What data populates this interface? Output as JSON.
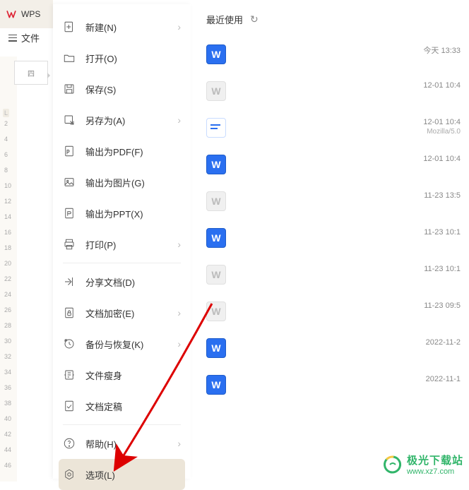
{
  "titlebar": {
    "app_label": "WPS"
  },
  "file_tab": {
    "label": "文件"
  },
  "menu": {
    "items": [
      {
        "label": "新建(N)",
        "icon": "new",
        "chevron": true
      },
      {
        "label": "打开(O)",
        "icon": "open",
        "chevron": false
      },
      {
        "label": "保存(S)",
        "icon": "save",
        "chevron": false
      },
      {
        "label": "另存为(A)",
        "icon": "save-as",
        "chevron": true
      },
      {
        "label": "输出为PDF(F)",
        "icon": "pdf",
        "chevron": false
      },
      {
        "label": "输出为图片(G)",
        "icon": "image",
        "chevron": false
      },
      {
        "label": "输出为PPT(X)",
        "icon": "ppt",
        "chevron": false
      },
      {
        "label": "打印(P)",
        "icon": "print",
        "chevron": true
      },
      {
        "label": "分享文档(D)",
        "icon": "share",
        "chevron": false
      },
      {
        "label": "文档加密(E)",
        "icon": "encrypt",
        "chevron": true
      },
      {
        "label": "备份与恢复(K)",
        "icon": "backup",
        "chevron": true
      },
      {
        "label": "文件瘦身",
        "icon": "slim",
        "chevron": false
      },
      {
        "label": "文档定稿",
        "icon": "finalize",
        "chevron": false
      },
      {
        "label": "帮助(H)",
        "icon": "help",
        "chevron": true
      },
      {
        "label": "选项(L)",
        "icon": "options",
        "chevron": false,
        "selected": true
      }
    ]
  },
  "recent": {
    "header": "最近使用",
    "items": [
      {
        "icon": "w-blue",
        "date": "今天  13:33"
      },
      {
        "icon": "w-gray",
        "date": "12-01 10:4"
      },
      {
        "icon": "list-blue",
        "date": "12-01 10:4",
        "sub": "Mozilla/5.0"
      },
      {
        "icon": "w-blue",
        "date": "12-01 10:4"
      },
      {
        "icon": "w-gray",
        "date": "11-23 13:5"
      },
      {
        "icon": "w-blue",
        "date": "11-23 10:1"
      },
      {
        "icon": "w-gray",
        "date": "11-23 10:1"
      },
      {
        "icon": "w-gray",
        "date": "11-23 09:5"
      },
      {
        "icon": "w-blue",
        "date": "2022-11-2"
      },
      {
        "icon": "w-blue",
        "date": "2022-11-1"
      }
    ]
  },
  "ruler": {
    "thumb_label": "四",
    "marker": "L",
    "ticks": [
      "2",
      "4",
      "6",
      "8",
      "10",
      "12",
      "14",
      "16",
      "18",
      "20",
      "22",
      "24",
      "26",
      "28",
      "30",
      "32",
      "34",
      "36",
      "38",
      "40",
      "42",
      "44",
      "46"
    ]
  },
  "watermark": {
    "line1": "极光下载站",
    "line2": "www.xz7.com"
  }
}
